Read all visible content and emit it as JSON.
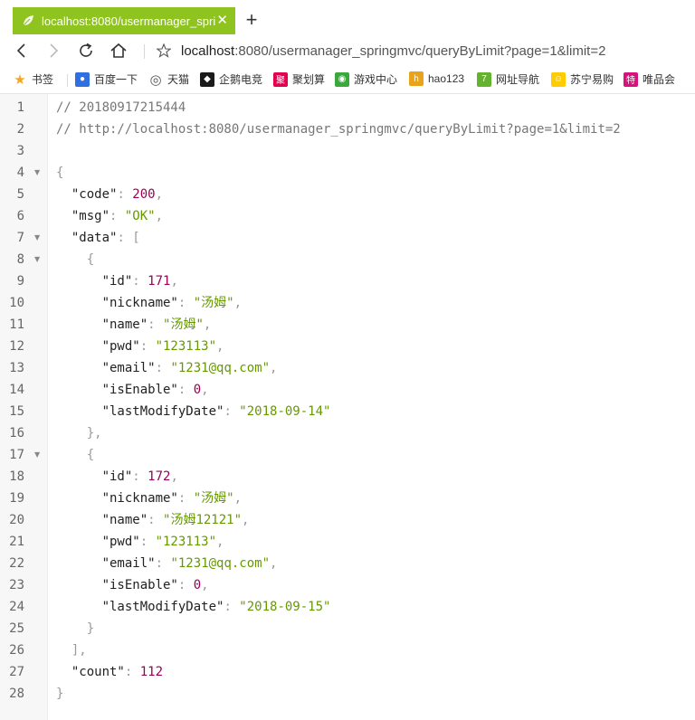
{
  "browser": {
    "tab": {
      "title": "localhost:8080/usermanager_spri",
      "close": "✕",
      "accent": "#8fc31f"
    },
    "new_tab": "+",
    "address": {
      "host": "localhost",
      "rest": ":8080/usermanager_springmvc/queryByLimit?page=1&limit=2"
    },
    "bookmarks": [
      {
        "label": "书签",
        "icon": "star-icon",
        "color": "#f5a623"
      },
      {
        "label": "百度一下",
        "icon": "baidu-paw-icon",
        "color": "#2f6fe0"
      },
      {
        "label": "天猫",
        "icon": "globe-icon",
        "color": "#555555"
      },
      {
        "label": "企鹅电竞",
        "icon": "penguin-esports-icon",
        "color": "#1a1a1a"
      },
      {
        "label": "聚划算",
        "icon": "juhuasuan-icon",
        "color": "#e5004f"
      },
      {
        "label": "游戏中心",
        "icon": "gamepad-icon",
        "color": "#3aa83a"
      },
      {
        "label": "hao123",
        "icon": "hao123-icon",
        "color": "#e8a31a"
      },
      {
        "label": "网址导航",
        "icon": "7654-icon",
        "color": "#63b32e"
      },
      {
        "label": "苏宁易购",
        "icon": "suning-icon",
        "color": "#ffcc00"
      },
      {
        "label": "唯品会",
        "icon": "vipshop-icon",
        "color": "#d8127d"
      }
    ]
  },
  "json_view": {
    "lines": [
      {
        "n": "1",
        "fold": false,
        "tokens": [
          {
            "t": "// 20180917215444",
            "c": "comment"
          }
        ]
      },
      {
        "n": "2",
        "fold": false,
        "tokens": [
          {
            "t": "// http://localhost:8080/usermanager_springmvc/queryByLimit?page=1&limit=2",
            "c": "comment"
          }
        ]
      },
      {
        "n": "3",
        "fold": false,
        "tokens": []
      },
      {
        "n": "4",
        "fold": true,
        "tokens": [
          {
            "t": "{",
            "c": "punc"
          }
        ]
      },
      {
        "n": "5",
        "fold": false,
        "tokens": [
          {
            "t": "  \"code\"",
            "c": "key"
          },
          {
            "t": ": ",
            "c": "punc"
          },
          {
            "t": "200",
            "c": "num"
          },
          {
            "t": ",",
            "c": "punc"
          }
        ]
      },
      {
        "n": "6",
        "fold": false,
        "tokens": [
          {
            "t": "  \"msg\"",
            "c": "key"
          },
          {
            "t": ": ",
            "c": "punc"
          },
          {
            "t": "\"OK\"",
            "c": "str"
          },
          {
            "t": ",",
            "c": "punc"
          }
        ]
      },
      {
        "n": "7",
        "fold": true,
        "tokens": [
          {
            "t": "  \"data\"",
            "c": "key"
          },
          {
            "t": ": [",
            "c": "punc"
          }
        ]
      },
      {
        "n": "8",
        "fold": true,
        "tokens": [
          {
            "t": "    {",
            "c": "punc"
          }
        ]
      },
      {
        "n": "9",
        "fold": false,
        "tokens": [
          {
            "t": "      \"id\"",
            "c": "key"
          },
          {
            "t": ": ",
            "c": "punc"
          },
          {
            "t": "171",
            "c": "num"
          },
          {
            "t": ",",
            "c": "punc"
          }
        ]
      },
      {
        "n": "10",
        "fold": false,
        "tokens": [
          {
            "t": "      \"nickname\"",
            "c": "key"
          },
          {
            "t": ": ",
            "c": "punc"
          },
          {
            "t": "\"汤姆\"",
            "c": "str"
          },
          {
            "t": ",",
            "c": "punc"
          }
        ]
      },
      {
        "n": "11",
        "fold": false,
        "tokens": [
          {
            "t": "      \"name\"",
            "c": "key"
          },
          {
            "t": ": ",
            "c": "punc"
          },
          {
            "t": "\"汤姆\"",
            "c": "str"
          },
          {
            "t": ",",
            "c": "punc"
          }
        ]
      },
      {
        "n": "12",
        "fold": false,
        "tokens": [
          {
            "t": "      \"pwd\"",
            "c": "key"
          },
          {
            "t": ": ",
            "c": "punc"
          },
          {
            "t": "\"123113\"",
            "c": "str"
          },
          {
            "t": ",",
            "c": "punc"
          }
        ]
      },
      {
        "n": "13",
        "fold": false,
        "tokens": [
          {
            "t": "      \"email\"",
            "c": "key"
          },
          {
            "t": ": ",
            "c": "punc"
          },
          {
            "t": "\"1231@qq.com\"",
            "c": "str"
          },
          {
            "t": ",",
            "c": "punc"
          }
        ]
      },
      {
        "n": "14",
        "fold": false,
        "tokens": [
          {
            "t": "      \"isEnable\"",
            "c": "key"
          },
          {
            "t": ": ",
            "c": "punc"
          },
          {
            "t": "0",
            "c": "num"
          },
          {
            "t": ",",
            "c": "punc"
          }
        ]
      },
      {
        "n": "15",
        "fold": false,
        "tokens": [
          {
            "t": "      \"lastModifyDate\"",
            "c": "key"
          },
          {
            "t": ": ",
            "c": "punc"
          },
          {
            "t": "\"2018-09-14\"",
            "c": "str"
          }
        ]
      },
      {
        "n": "16",
        "fold": false,
        "tokens": [
          {
            "t": "    },",
            "c": "punc"
          }
        ]
      },
      {
        "n": "17",
        "fold": true,
        "tokens": [
          {
            "t": "    {",
            "c": "punc"
          }
        ]
      },
      {
        "n": "18",
        "fold": false,
        "tokens": [
          {
            "t": "      \"id\"",
            "c": "key"
          },
          {
            "t": ": ",
            "c": "punc"
          },
          {
            "t": "172",
            "c": "num"
          },
          {
            "t": ",",
            "c": "punc"
          }
        ]
      },
      {
        "n": "19",
        "fold": false,
        "tokens": [
          {
            "t": "      \"nickname\"",
            "c": "key"
          },
          {
            "t": ": ",
            "c": "punc"
          },
          {
            "t": "\"汤姆\"",
            "c": "str"
          },
          {
            "t": ",",
            "c": "punc"
          }
        ]
      },
      {
        "n": "20",
        "fold": false,
        "tokens": [
          {
            "t": "      \"name\"",
            "c": "key"
          },
          {
            "t": ": ",
            "c": "punc"
          },
          {
            "t": "\"汤姆12121\"",
            "c": "str"
          },
          {
            "t": ",",
            "c": "punc"
          }
        ]
      },
      {
        "n": "21",
        "fold": false,
        "tokens": [
          {
            "t": "      \"pwd\"",
            "c": "key"
          },
          {
            "t": ": ",
            "c": "punc"
          },
          {
            "t": "\"123113\"",
            "c": "str"
          },
          {
            "t": ",",
            "c": "punc"
          }
        ]
      },
      {
        "n": "22",
        "fold": false,
        "tokens": [
          {
            "t": "      \"email\"",
            "c": "key"
          },
          {
            "t": ": ",
            "c": "punc"
          },
          {
            "t": "\"1231@qq.com\"",
            "c": "str"
          },
          {
            "t": ",",
            "c": "punc"
          }
        ]
      },
      {
        "n": "23",
        "fold": false,
        "tokens": [
          {
            "t": "      \"isEnable\"",
            "c": "key"
          },
          {
            "t": ": ",
            "c": "punc"
          },
          {
            "t": "0",
            "c": "num"
          },
          {
            "t": ",",
            "c": "punc"
          }
        ]
      },
      {
        "n": "24",
        "fold": false,
        "tokens": [
          {
            "t": "      \"lastModifyDate\"",
            "c": "key"
          },
          {
            "t": ": ",
            "c": "punc"
          },
          {
            "t": "\"2018-09-15\"",
            "c": "str"
          }
        ]
      },
      {
        "n": "25",
        "fold": false,
        "tokens": [
          {
            "t": "    }",
            "c": "punc"
          }
        ]
      },
      {
        "n": "26",
        "fold": false,
        "tokens": [
          {
            "t": "  ],",
            "c": "punc"
          }
        ]
      },
      {
        "n": "27",
        "fold": false,
        "tokens": [
          {
            "t": "  \"count\"",
            "c": "key"
          },
          {
            "t": ": ",
            "c": "punc"
          },
          {
            "t": "112",
            "c": "num"
          }
        ]
      },
      {
        "n": "28",
        "fold": false,
        "tokens": [
          {
            "t": "}",
            "c": "punc"
          }
        ]
      }
    ]
  }
}
